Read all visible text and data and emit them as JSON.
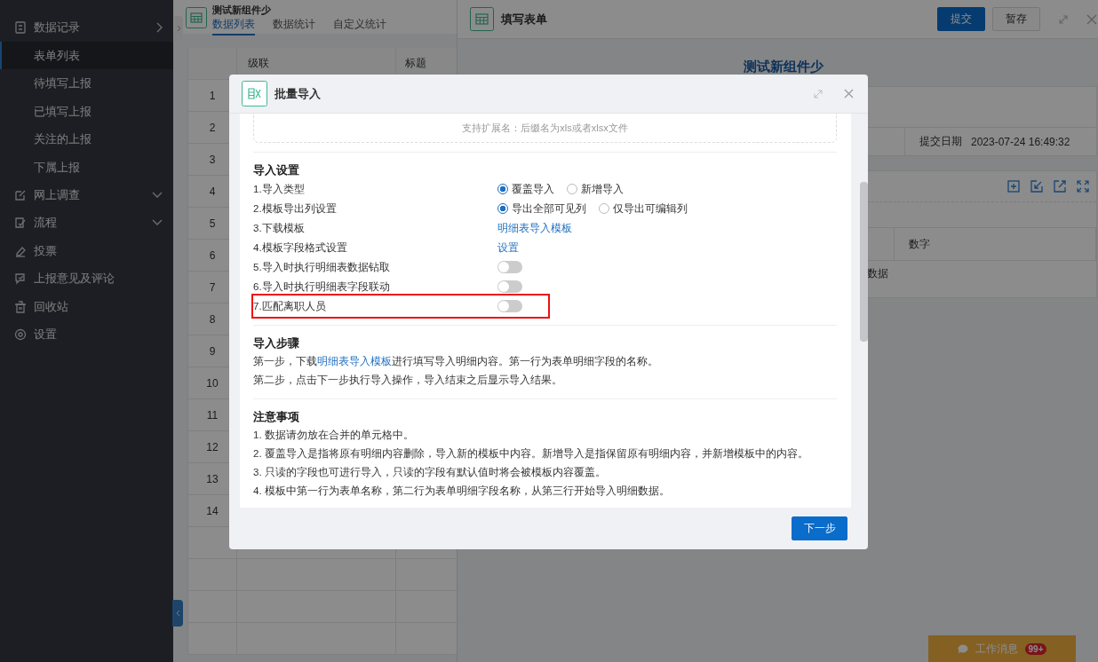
{
  "sidebar": {
    "items": [
      {
        "label": "数据记录",
        "has_submenu": true,
        "children": [
          {
            "label": "表单列表",
            "selected": true
          },
          {
            "label": "待填写上报",
            "selected": false
          },
          {
            "label": "已填写上报",
            "selected": false
          },
          {
            "label": "关注的上报",
            "selected": false
          },
          {
            "label": "下属上报",
            "selected": false
          }
        ]
      },
      {
        "label": "网上调查",
        "has_submenu": true
      },
      {
        "label": "流程",
        "has_submenu": true
      },
      {
        "label": "投票",
        "has_submenu": false
      },
      {
        "label": "上报意见及评论",
        "has_submenu": false
      },
      {
        "label": "回收站",
        "has_submenu": false
      },
      {
        "label": "设置",
        "has_submenu": false
      }
    ]
  },
  "list_panel": {
    "title": "测试新组件少",
    "tabs": [
      {
        "label": "数据列表",
        "selected": true
      },
      {
        "label": "数据统计",
        "selected": false
      },
      {
        "label": "自定义统计",
        "selected": false
      }
    ],
    "table": {
      "columns": [
        "级联",
        "标题"
      ],
      "rows": [
        "1",
        "2",
        "3",
        "4",
        "5",
        "6",
        "7",
        "8",
        "9",
        "10",
        "11",
        "12",
        "13",
        "14"
      ]
    }
  },
  "form_panel": {
    "title": "填写表单",
    "buttons": [
      {
        "label": "提交",
        "kind": "primary"
      },
      {
        "label": "暂存",
        "kind": "default"
      }
    ],
    "form_title": "测试新组件少",
    "fields": [
      {
        "label": "提交日期",
        "value": "2023-07-24 16:49:32"
      }
    ],
    "detail_table": {
      "columns": [
        "数字"
      ],
      "empty_text": "数据"
    }
  },
  "dialog": {
    "title": "批量导入",
    "upload_hint": "支持扩展名：后缀名为xls或者xlsx文件",
    "settings": {
      "heading": "导入设置",
      "rows": [
        {
          "label": "1.导入类型",
          "kind": "radio",
          "highlighted": false,
          "options": [
            {
              "label": "覆盖导入",
              "selected": true
            },
            {
              "label": "新增导入",
              "selected": false
            }
          ]
        },
        {
          "label": "2.模板导出列设置",
          "kind": "radio",
          "highlighted": false,
          "options": [
            {
              "label": "导出全部可见列",
              "selected": true
            },
            {
              "label": "仅导出可编辑列",
              "selected": false
            }
          ]
        },
        {
          "label": "3.下载模板",
          "kind": "link",
          "highlighted": false,
          "link": "明细表导入模板"
        },
        {
          "label": "4.模板字段格式设置",
          "kind": "link",
          "highlighted": false,
          "link": "设置"
        },
        {
          "label": "5.导入时执行明细表数据钻取",
          "kind": "toggle",
          "highlighted": false,
          "on": false
        },
        {
          "label": "6.导入时执行明细表字段联动",
          "kind": "toggle",
          "highlighted": false,
          "on": false
        },
        {
          "label": "7.匹配离职人员",
          "kind": "toggle",
          "highlighted": true,
          "on": false
        }
      ]
    },
    "steps": {
      "heading": "导入步骤",
      "lines": [
        {
          "before": "第一步，下载",
          "link": "明细表导入模板",
          "after": "进行填写导入明细内容。第一行为表单明细字段的名称。"
        },
        {
          "before": "第二步，点击下一步执行导入操作，导入结束之后显示导入结果。"
        }
      ]
    },
    "notes": {
      "heading": "注意事项",
      "lines": [
        "1. 数据请勿放在合并的单元格中。",
        "2. 覆盖导入是指将原有明细内容删除，导入新的模板中内容。新增导入是指保留原有明细内容，并新增模板中的内容。",
        "3. 只读的字段也可进行导入，只读的字段有默认值时将会被模板内容覆盖。",
        "4. 模板中第一行为表单名称，第二行为表单明细字段名称，从第三行开始导入明细数据。"
      ]
    },
    "next_button": "下一步"
  },
  "message_bar": {
    "label": "工作消息",
    "badge": "99+"
  }
}
